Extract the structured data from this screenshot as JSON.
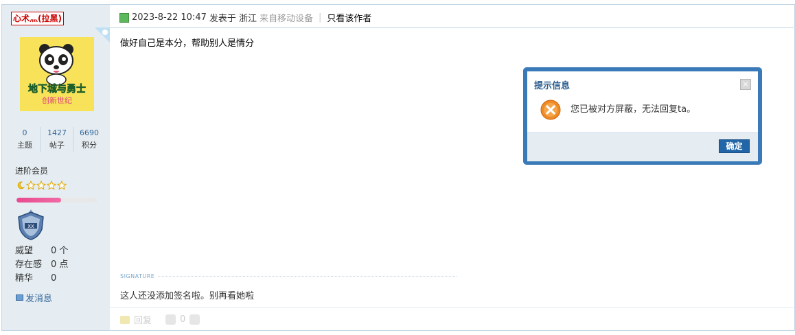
{
  "user": {
    "name": "心术灬(拉黑)",
    "stats": [
      {
        "value": "0",
        "label": "主题"
      },
      {
        "value": "1427",
        "label": "帖子"
      },
      {
        "value": "6690",
        "label": "积分"
      }
    ],
    "level": "进阶会员",
    "level_progress": 0.55,
    "info": [
      {
        "key": "威望",
        "value": "0 个"
      },
      {
        "key": "存在感",
        "value": "0 点"
      },
      {
        "key": "精华",
        "value": "0"
      }
    ],
    "send_message": "发消息"
  },
  "avatar": {
    "line1": "地下城与勇士",
    "line2": "创新世纪"
  },
  "post": {
    "datetime": "2023-8-22 10:47",
    "posted_in": "发表于 浙江",
    "source": "来自移动设备",
    "separator": "|",
    "only_author": "只看该作者",
    "content": "做好自己是本分，帮助别人是情分",
    "signature_label": "SIGNATURE",
    "signature": "这人还没添加签名啦。别再看她啦",
    "reply": "回复",
    "likes": "0"
  },
  "dialog": {
    "title": "提示信息",
    "message": "您已被对方屏蔽，无法回复ta。",
    "ok": "确定",
    "close": "×"
  },
  "colors": {
    "accent": "#3b7ab8",
    "username": "#cc0000",
    "link": "#336699",
    "sidebar_bg": "#e5edf2"
  }
}
